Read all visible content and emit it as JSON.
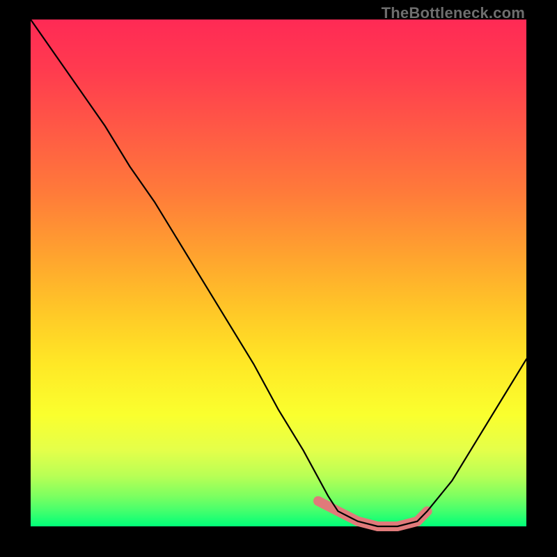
{
  "watermark": "TheBottleneck.com",
  "chart_data": {
    "type": "line",
    "title": "",
    "xlabel": "",
    "ylabel": "",
    "xlim": [
      0,
      100
    ],
    "ylim": [
      0,
      100
    ],
    "series": [
      {
        "name": "curve",
        "x": [
          0,
          5,
          10,
          15,
          20,
          25,
          30,
          35,
          40,
          45,
          50,
          55,
          60,
          62,
          66,
          70,
          74,
          78,
          80,
          85,
          90,
          95,
          100
        ],
        "values": [
          100,
          93,
          86,
          79,
          71,
          64,
          56,
          48,
          40,
          32,
          23,
          15,
          6,
          3,
          1,
          0,
          0,
          1,
          3,
          9,
          17,
          25,
          33
        ]
      }
    ],
    "highlight_segment": {
      "name": "salmon-band",
      "x": [
        58,
        62,
        66,
        70,
        74,
        78,
        80
      ],
      "values": [
        5,
        3,
        1,
        0,
        0,
        1,
        3
      ]
    },
    "colors": {
      "curve": "#000000",
      "highlight": "#e07a7a",
      "background_top": "#ff2a55",
      "background_bottom": "#00ff78"
    }
  }
}
